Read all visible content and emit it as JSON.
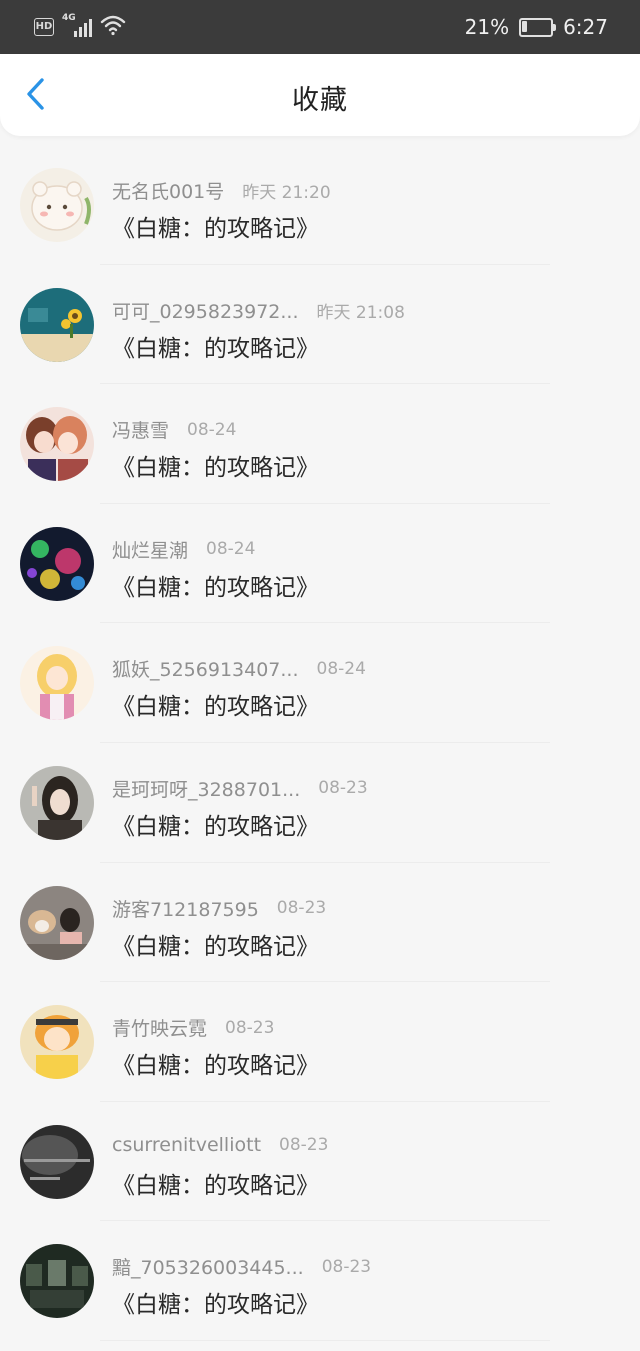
{
  "status_bar": {
    "hd_label": "HD",
    "network_label": "4G",
    "battery_percent": "21%",
    "battery_level": 0.21,
    "time": "6:27"
  },
  "header": {
    "title": "收藏",
    "back_icon": "chevron-left-icon",
    "accent_color": "#2a93e6"
  },
  "items": [
    {
      "user": "无名氏001号",
      "time": "昨天 21:20",
      "title": "《白糖：的攻略记》"
    },
    {
      "user": "可可_0295823972...",
      "time": "昨天 21:08",
      "title": "《白糖：的攻略记》"
    },
    {
      "user": "冯惠雪",
      "time": "08-24",
      "title": "《白糖：的攻略记》"
    },
    {
      "user": "灿烂星潮",
      "time": "08-24",
      "title": "《白糖：的攻略记》"
    },
    {
      "user": "狐妖_5256913407...",
      "time": "08-24",
      "title": "《白糖：的攻略记》"
    },
    {
      "user": "是珂珂呀_3288701...",
      "time": "08-23",
      "title": "《白糖：的攻略记》"
    },
    {
      "user": "游客712187595",
      "time": "08-23",
      "title": "《白糖：的攻略记》"
    },
    {
      "user": "青竹映云霓",
      "time": "08-23",
      "title": "《白糖：的攻略记》"
    },
    {
      "user": "csurrenitvelliott",
      "time": "08-23",
      "title": "《白糖：的攻略记》"
    },
    {
      "user": "黯_705326003445...",
      "time": "08-23",
      "title": "《白糖：的攻略记》"
    }
  ]
}
